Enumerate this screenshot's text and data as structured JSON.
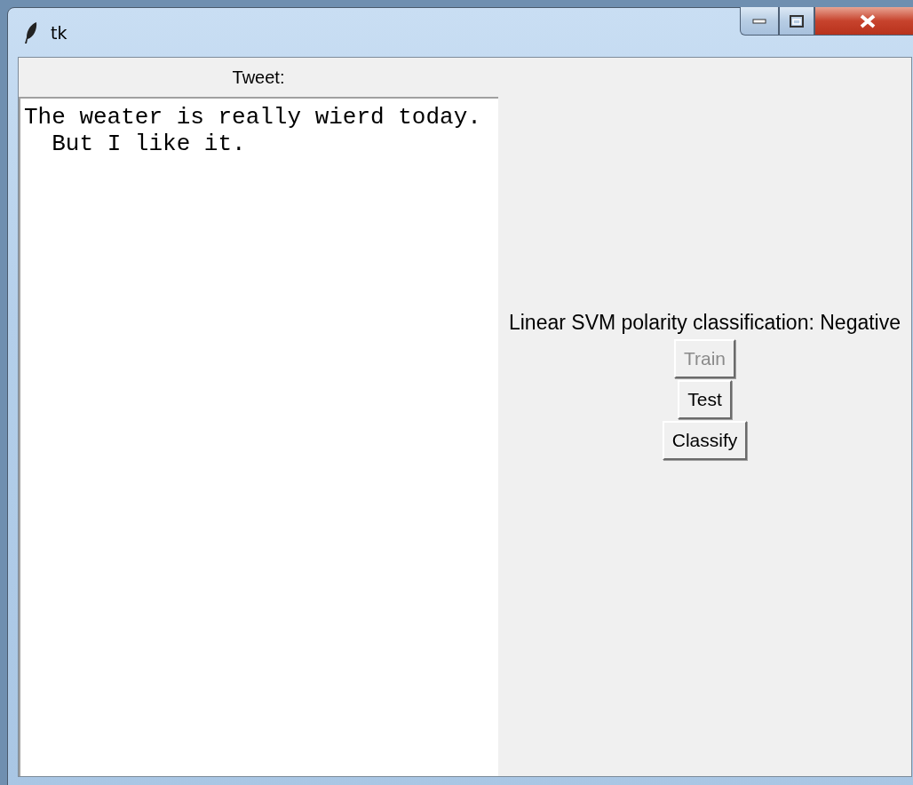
{
  "window": {
    "title": "tk"
  },
  "tweet_label": "Tweet:",
  "tweet_lines": [
    "The weater is really wierd today.",
    "  But I like it."
  ],
  "result": "Linear SVM polarity classification: Negative",
  "buttons": [
    {
      "label": "Train",
      "disabled": true
    },
    {
      "label": "Test",
      "disabled": false
    },
    {
      "label": "Classify",
      "disabled": false
    }
  ]
}
